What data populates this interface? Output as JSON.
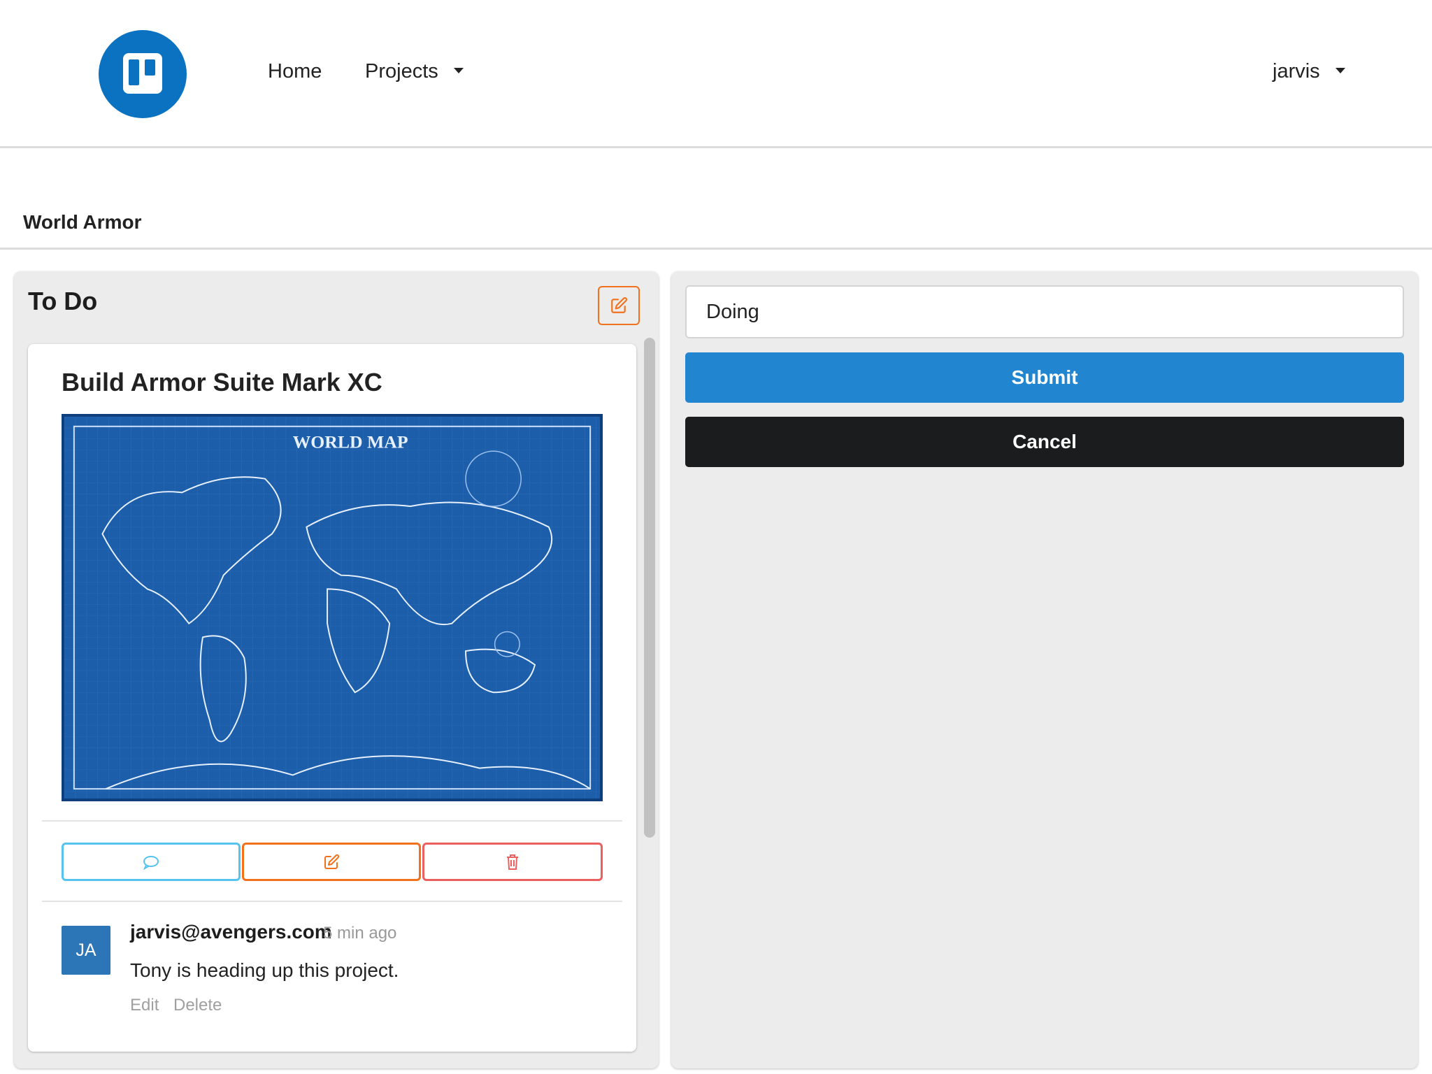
{
  "header": {
    "logo_icon": "trello-board-icon",
    "nav": [
      {
        "label": "Home"
      },
      {
        "label": "Projects",
        "has_dropdown": true
      }
    ],
    "user": {
      "label": "jarvis",
      "has_dropdown": true
    }
  },
  "board": {
    "title": "World Armor"
  },
  "columns": {
    "todo": {
      "title": "To Do",
      "edit_icon": "edit-icon",
      "card": {
        "title": "Build Armor Suite Mark XC",
        "image_description_icon": "blueprint-world-map-image",
        "image_text": "WORLD MAP",
        "actions": [
          {
            "icon": "comment-icon",
            "color": "#56c4ee"
          },
          {
            "icon": "edit-icon",
            "color": "#f2711c"
          },
          {
            "icon": "trash-icon",
            "color": "#ec5f5f"
          }
        ],
        "comment": {
          "avatar_initials": "JA",
          "author": "jarvis@avengers.com",
          "time": "5 min ago",
          "text": "Tony is heading up this project.",
          "edit_label": "Edit",
          "delete_label": "Delete"
        }
      }
    },
    "doing": {
      "input_value": "Doing",
      "submit_label": "Submit",
      "cancel_label": "Cancel"
    }
  },
  "colors": {
    "brand": "#0a72c1",
    "submit": "#2185d0",
    "cancel": "#1b1c1d",
    "edit_accent": "#f2711c",
    "comment_accent": "#56c4ee",
    "delete_accent": "#ec5f5f"
  }
}
